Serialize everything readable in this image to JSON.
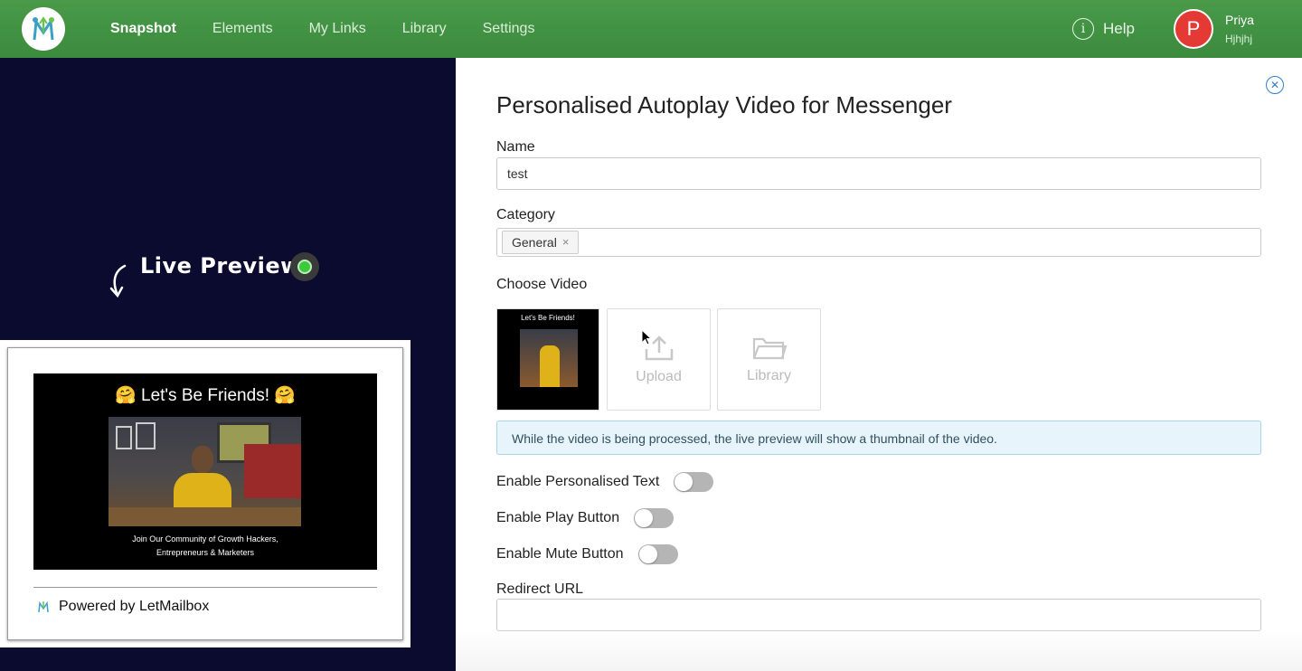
{
  "nav": {
    "items": [
      {
        "label": "Snapshot",
        "active": true
      },
      {
        "label": "Elements",
        "active": false
      },
      {
        "label": "My Links",
        "active": false
      },
      {
        "label": "Library",
        "active": false
      },
      {
        "label": "Settings",
        "active": false
      }
    ],
    "help_label": "Help",
    "user": {
      "initial": "P",
      "name": "Priya",
      "subtitle": "Hjhjhj",
      "avatar_color": "#e53935"
    }
  },
  "left": {
    "live_preview_label": "Live Preview",
    "preview": {
      "video_title": "Let's Be Friends!",
      "video_caption_line1": "Join Our Community of Growth Hackers,",
      "video_caption_line2": "Entrepreneurs & Marketers",
      "powered_by": "Powered by LetMailbox"
    }
  },
  "panel": {
    "title": "Personalised Autoplay Video for Messenger",
    "name_label": "Name",
    "name_value": "test",
    "category_label": "Category",
    "category_tag": "General",
    "choose_video_label": "Choose Video",
    "upload_label": "Upload",
    "library_label": "Library",
    "info_text": "While the video is being processed, the live preview will show a thumbnail of the video.",
    "toggles": [
      {
        "label": "Enable Personalised Text",
        "on": false
      },
      {
        "label": "Enable Play Button",
        "on": false
      },
      {
        "label": "Enable Mute Button",
        "on": false
      }
    ],
    "redirect_label": "Redirect URL",
    "redirect_value": ""
  },
  "colors": {
    "nav_green": "#3b8a3e",
    "dark_bg": "#0a0b2e",
    "accent_blue": "#2d7fd3",
    "info_bg": "#e8f4fb"
  }
}
